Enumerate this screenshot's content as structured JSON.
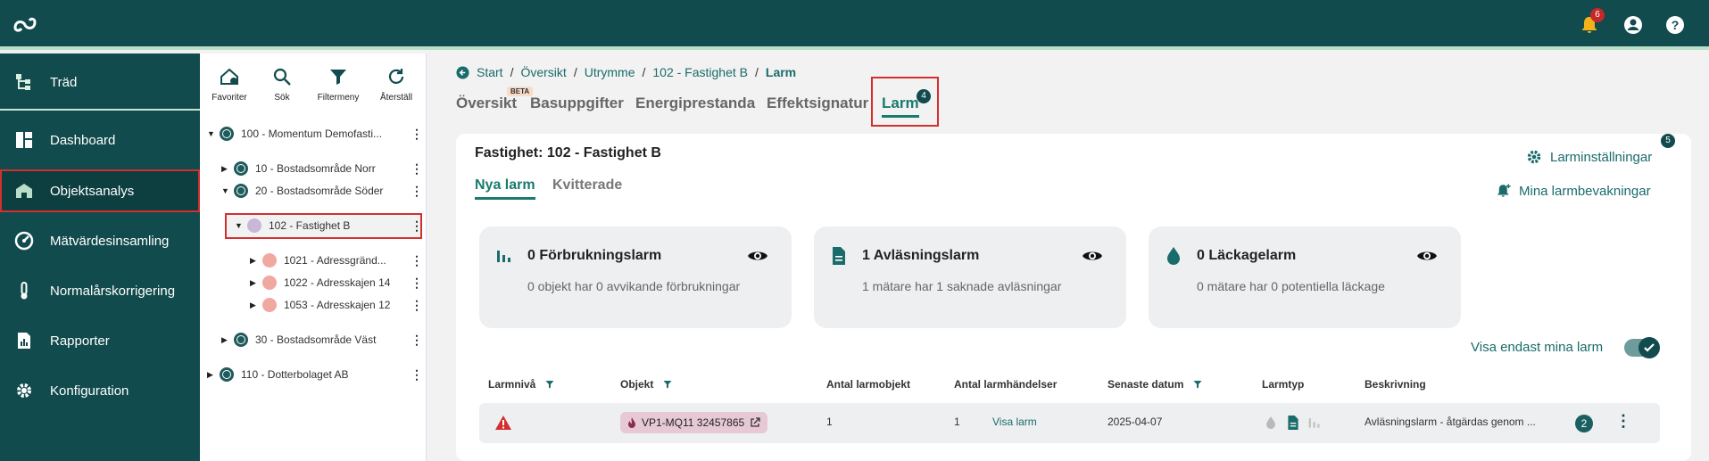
{
  "topbar": {
    "notification_count": "6"
  },
  "sidebar": {
    "items": [
      {
        "label": "Träd"
      },
      {
        "label": "Dashboard"
      },
      {
        "label": "Objektsanalys"
      },
      {
        "label": "Mätvärdesinsamling"
      },
      {
        "label": "Normalårskorrigering"
      },
      {
        "label": "Rapporter"
      },
      {
        "label": "Konfiguration"
      }
    ]
  },
  "tree": {
    "tools": [
      {
        "label": "Favoriter"
      },
      {
        "label": "Sök"
      },
      {
        "label": "Filtermeny"
      },
      {
        "label": "Återställ"
      }
    ],
    "nodes": [
      {
        "label": "100 - Momentum Demofasti..."
      },
      {
        "label": "10 - Bostadsområde Norr"
      },
      {
        "label": "20 - Bostadsområde Söder"
      },
      {
        "label": "102 - Fastighet B"
      },
      {
        "label": "1021 - Adressgränd..."
      },
      {
        "label": "1022 - Adresskajen 14"
      },
      {
        "label": "1053 - Adresskajen 12"
      },
      {
        "label": "30 - Bostadsområde Väst"
      },
      {
        "label": "110 - Dotterbolaget AB"
      }
    ]
  },
  "breadcrumb": [
    "Start",
    "Översikt",
    "Utrymme",
    "102 - Fastighet B",
    "Larm"
  ],
  "tabs": [
    {
      "label": "Översikt"
    },
    {
      "label": "Basuppgifter"
    },
    {
      "label": "Energiprestanda"
    },
    {
      "label": "Effektsignatur"
    },
    {
      "label": "Larm"
    }
  ],
  "beta_label": "BETA",
  "larm_tab_badge": "4",
  "content": {
    "title": "Fastighet: 102 - Fastighet B",
    "subtabs": [
      "Nya larm",
      "Kvitterade"
    ],
    "settings_link": "Larminställningar",
    "settings_badge": "5",
    "subscriptions_link": "Mina larmbevakningar",
    "toggle_label": "Visa endast mina larm",
    "toggle_on": true
  },
  "alarm_cards": [
    {
      "title": "0 Förbrukningslarm",
      "subtitle": "0 objekt har 0 avvikande förbrukningar",
      "icon": "bar-chart-icon"
    },
    {
      "title": "1 Avläsningslarm",
      "subtitle": "1 mätare har 1 saknade avläsningar",
      "icon": "document-icon"
    },
    {
      "title": "0 Läckagelarm",
      "subtitle": "0 mätare har 0 potentiella läckage",
      "icon": "drop-icon"
    }
  ],
  "table": {
    "headers": [
      "Larmnivå",
      "Objekt",
      "Antal larmobjekt",
      "Antal larmhändelser",
      "Senaste datum",
      "Larmtyp",
      "Beskrivning"
    ],
    "rows": [
      {
        "object": "VP1-MQ11 32457865",
        "alarm_objects": "1",
        "alarm_events": "1",
        "show_link": "Visa larm",
        "latest_date": "2025-04-07",
        "description": "Avläsningslarm - åtgärdas genom ...",
        "count_badge": "2"
      }
    ]
  },
  "colors": {
    "primary": "#124b4d",
    "accent": "#1a7a6e",
    "highlight": "#d32f2f"
  }
}
